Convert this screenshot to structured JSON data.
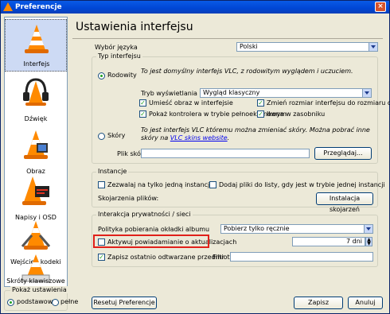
{
  "window": {
    "title": "Preferencje"
  },
  "sidebar": {
    "items": [
      {
        "label": "Interfejs",
        "icon": "vlc-cone-icon",
        "selected": true
      },
      {
        "label": "Dźwięk",
        "icon": "headphones-icon",
        "selected": false
      },
      {
        "label": "Obraz",
        "icon": "video-cone-icon",
        "selected": false
      },
      {
        "label": "Napisy i OSD",
        "icon": "subtitles-icon",
        "selected": false
      },
      {
        "label": "Wejście i kodeki",
        "icon": "codec-cone-icon",
        "selected": false
      },
      {
        "label": "Skróty klawiszowe",
        "icon": "hotkeys-cone-icon",
        "selected": false
      }
    ],
    "show_settings": {
      "title": "Pokaż ustawienia",
      "basic": "podstawowe",
      "full": "pełne",
      "selected": "basic"
    }
  },
  "main": {
    "title": "Ustawienia interfejsu",
    "language": {
      "label": "Wybór języka",
      "value": "Polski"
    },
    "interface_type": {
      "title": "Typ interfejsu",
      "native": {
        "label": "Rodowity",
        "description": "To jest domyślny interfejs VLC, z rodowitym wyglądem i uczuciem.",
        "display_mode_label": "Tryb wyświetlania",
        "display_mode_value": "Wygląd klasyczny",
        "checks": [
          {
            "label": "Umieść obraz w interfejsie",
            "checked": true
          },
          {
            "label": "Zmień rozmiar interfejsu do rozmiaru obrazu",
            "checked": true
          },
          {
            "label": "Pokaż kontrolera w trybie pełnoekranowym",
            "checked": true
          },
          {
            "label": "Ikona w zasobniku",
            "checked": true
          }
        ]
      },
      "skins": {
        "label": "Skóry",
        "description_1": "To jest interfejs VLC któremu można zmieniać skóry. Można pobrać inne skóry na ",
        "link": "VLC skins website",
        "description_2": ".",
        "skin_file_label": "Plik skóry",
        "skin_file_value": "",
        "browse_button": "Przeglądaj..."
      },
      "selected": "native"
    },
    "instances": {
      "title": "Instancje",
      "one_instance": {
        "label": "Zezwalaj na tylko jedną instancję",
        "checked": false
      },
      "enqueue": {
        "label": "Dodaj pliki do listy, gdy jest w trybie jednej instancji",
        "checked": false
      },
      "associations_label": "Skojarzenia plików:",
      "associations_button": "Instalacja skojarzeń"
    },
    "privacy": {
      "title": "Interakcja prywatności / sieci",
      "art_policy_label": "Polityka pobierania okładki albumu",
      "art_policy_value": "Pobierz tylko ręcznie",
      "updates": {
        "label": "Aktywuj powiadamianie o aktualizacjach",
        "checked": false,
        "highlighted": true
      },
      "update_days": "7 dni",
      "recent": {
        "label": "Zapisz ostatnio odtwarzane przedmioty",
        "checked": true
      },
      "filter_label": "Filtr",
      "filter_value": ""
    }
  },
  "footer": {
    "reset": "Resetuj Preferencje",
    "save": "Zapisz",
    "cancel": "Anuluj"
  },
  "colors": {
    "title_bar": "#0046d5",
    "highlight": "#e0201a",
    "selection": "#cddaf4"
  }
}
